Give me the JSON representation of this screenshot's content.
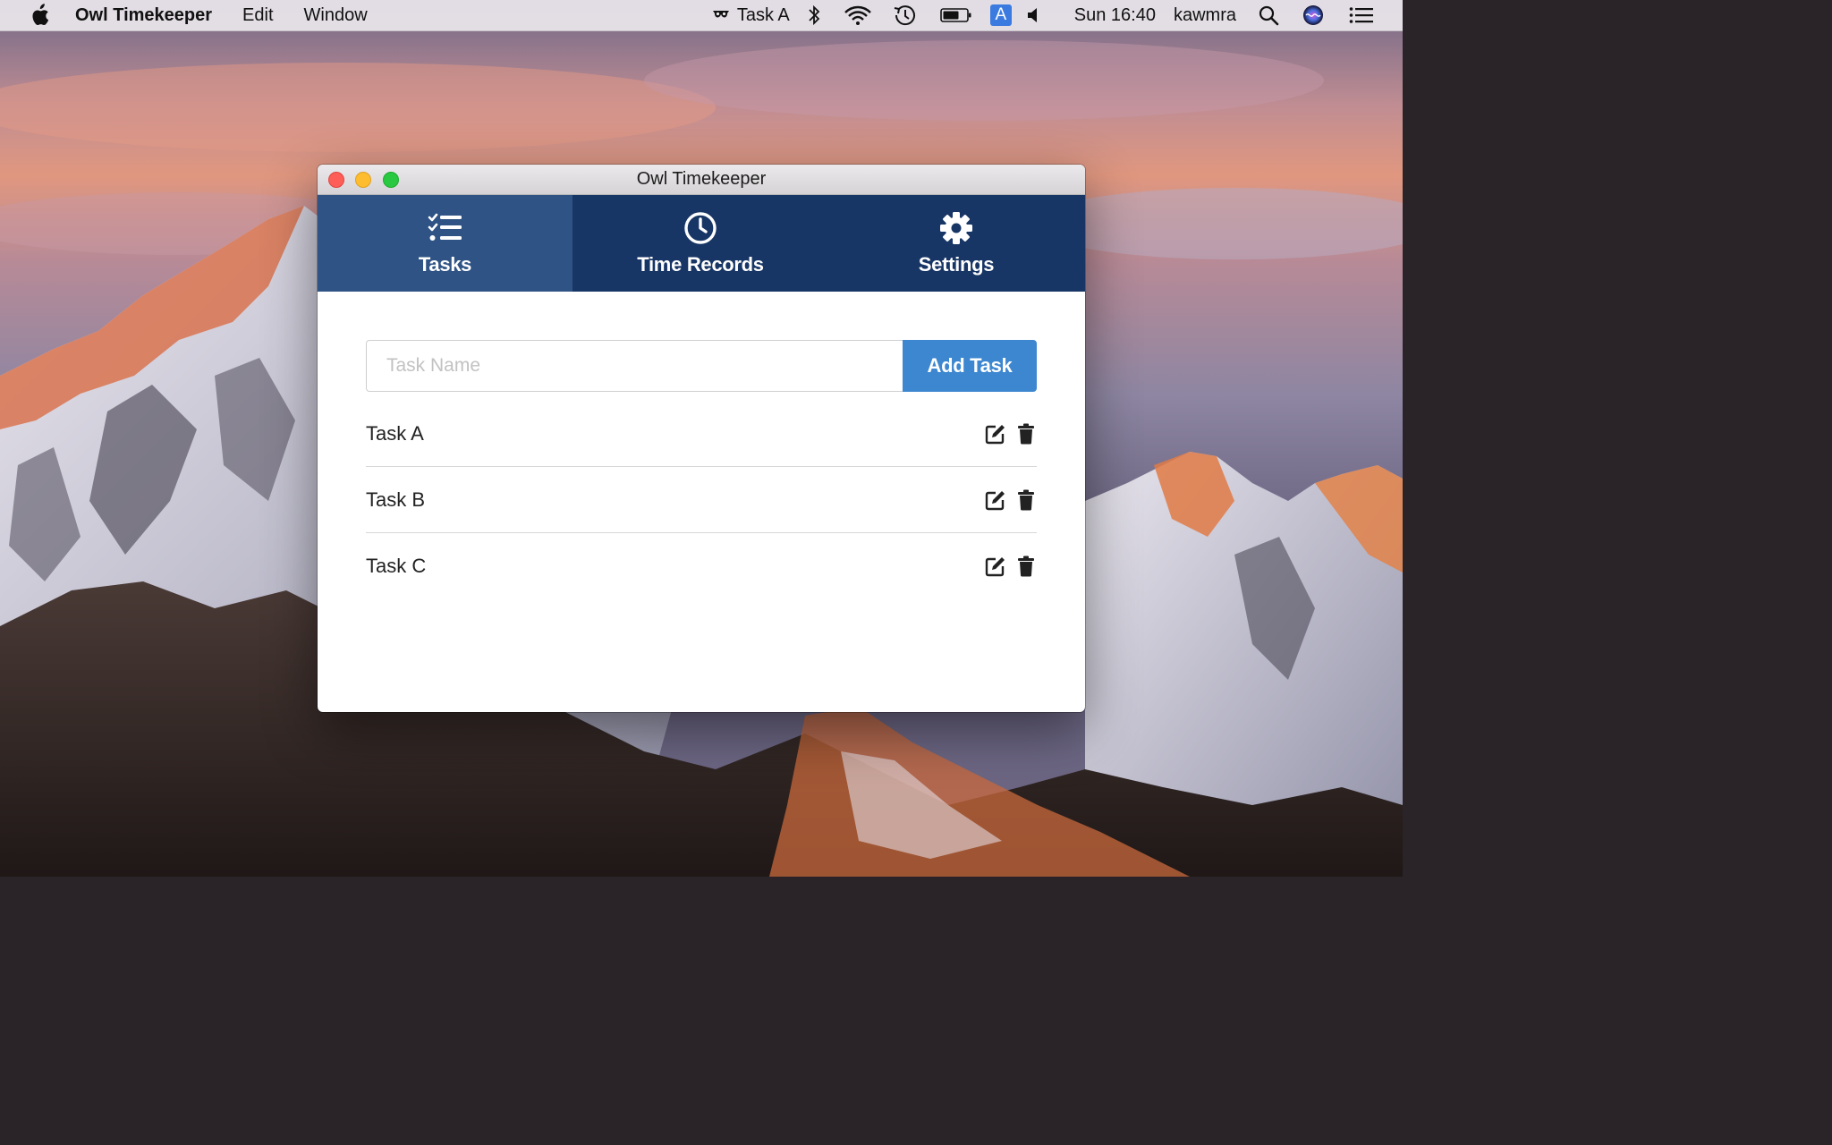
{
  "menubar": {
    "app_name": "Owl Timekeeper",
    "menus": [
      "Edit",
      "Window"
    ],
    "status_task": "Task A",
    "clock": "Sun 16:40",
    "user": "kawmra",
    "input_source": "A"
  },
  "window": {
    "title": "Owl Timekeeper"
  },
  "tabs": [
    {
      "label": "Tasks",
      "icon": "tasks-list-icon",
      "active": true
    },
    {
      "label": "Time Records",
      "icon": "clock-icon",
      "active": false
    },
    {
      "label": "Settings",
      "icon": "gear-icon",
      "active": false
    }
  ],
  "add_task": {
    "placeholder": "Task Name",
    "value": "",
    "button_label": "Add Task"
  },
  "tasks": [
    {
      "name": "Task A"
    },
    {
      "name": "Task B"
    },
    {
      "name": "Task C"
    }
  ],
  "colors": {
    "tab_bar": "#173565",
    "tab_active": "#2e5384",
    "add_button": "#3d87d0"
  }
}
